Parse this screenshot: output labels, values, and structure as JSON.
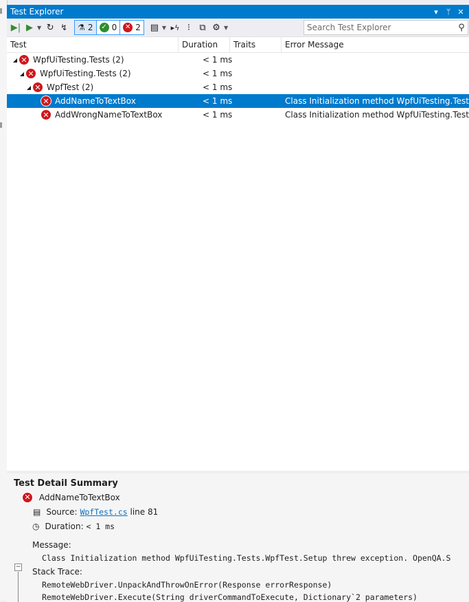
{
  "window": {
    "title": "Test Explorer",
    "buttons": [
      "▾",
      "ᛘ",
      "✕"
    ]
  },
  "toolbar": {
    "buttons": [
      "run-all",
      "run",
      "repeat-last",
      "cancel"
    ],
    "filters": [
      {
        "name": "total",
        "count": "2"
      },
      {
        "name": "passed",
        "count": "0"
      },
      {
        "name": "failed",
        "count": "2"
      }
    ],
    "search_placeholder": "Search Test Explorer"
  },
  "columns": [
    "Test",
    "Duration",
    "Traits",
    "Error Message"
  ],
  "tree": [
    {
      "name": "WpfUiTesting.Tests",
      "count": "(2)",
      "duration": "< 1 ms",
      "error": "",
      "level": 0,
      "expandable": true
    },
    {
      "name": "WpfUiTesting.Tests",
      "count": "(2)",
      "duration": "< 1 ms",
      "error": "",
      "level": 1,
      "expandable": true
    },
    {
      "name": "WpfTest",
      "count": "(2)",
      "duration": "< 1 ms",
      "error": "",
      "level": 2,
      "expandable": true
    },
    {
      "name": "AddNameToTextBox",
      "count": "",
      "duration": "< 1 ms",
      "error": "Class Initialization method WpfUiTesting.Tests...",
      "level": 3,
      "expandable": false,
      "selected": true
    },
    {
      "name": "AddWrongNameToTextBox",
      "count": "",
      "duration": "< 1 ms",
      "error": "Class Initialization method WpfUiTesting.Tests...",
      "level": 3,
      "expandable": false
    }
  ],
  "detail": {
    "heading": "Test Detail Summary",
    "test_name": "AddNameToTextBox",
    "source_label": "Source:",
    "source_file": "WpfTest.cs",
    "source_line": "line 81",
    "duration_label": "Duration:",
    "duration_value": "< 1 ms",
    "message_label": "Message:",
    "message_text": "Class Initialization method WpfUiTesting.Tests.WpfTest.Setup threw exception. OpenQA.S",
    "stack_label": "Stack Trace:",
    "stack_lines": [
      "RemoteWebDriver.UnpackAndThrowOnError(Response errorResponse)",
      "RemoteWebDriver.Execute(String driverCommandToExecute, Dictionary`2 parameters)"
    ]
  },
  "colors": {
    "accent": "#007acc",
    "fail": "#d0171b",
    "pass": "#2d8f2d"
  }
}
